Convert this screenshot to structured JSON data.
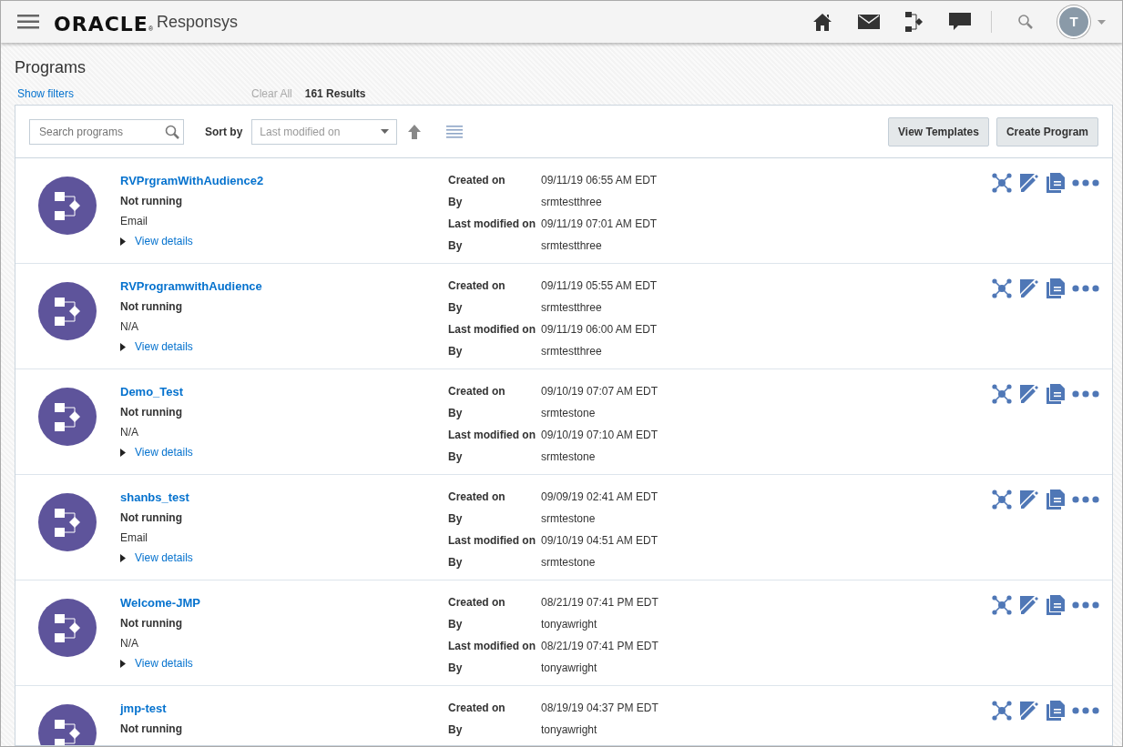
{
  "header": {
    "logo": "ORACLE",
    "logo_mark": "®",
    "product": "Responsys",
    "avatar_initial": "T"
  },
  "page_title": "Programs",
  "filter_bar": {
    "show_filters": "Show filters",
    "clear_all": "Clear All",
    "results": "161 Results"
  },
  "toolbar": {
    "search": {
      "placeholder": "Search programs"
    },
    "sort_label": "Sort by",
    "sort": {
      "placeholder": "Last modified on"
    },
    "buttons": [
      "View Templates",
      "Create Program"
    ]
  },
  "programs": [
    {
      "name": "RVPrgramWithAudience2",
      "status": "Not running",
      "type": "Email",
      "toggle": "View details",
      "expanded": false,
      "details": [
        {
          "label": "Created on",
          "value": "09/11/19 06:55 AM EDT"
        },
        {
          "label": "By",
          "value": "srmtestthree"
        },
        {
          "label": "Last modified on",
          "value": "09/11/19 07:01 AM EDT"
        },
        {
          "label": "By",
          "value": "srmtestthree"
        }
      ]
    },
    {
      "name": "RVProgramwithAudience",
      "status": "Not running",
      "type": "N/A",
      "toggle": "View details",
      "expanded": false,
      "details": [
        {
          "label": "Created on",
          "value": "09/11/19 05:55 AM EDT"
        },
        {
          "label": "By",
          "value": "srmtestthree"
        },
        {
          "label": "Last modified on",
          "value": "09/11/19 06:00 AM EDT"
        },
        {
          "label": "By",
          "value": "srmtestthree"
        }
      ]
    },
    {
      "name": "Demo_Test",
      "status": "Not running",
      "type": "N/A",
      "toggle": "View details",
      "expanded": false,
      "details": [
        {
          "label": "Created on",
          "value": "09/10/19 07:07 AM EDT"
        },
        {
          "label": "By",
          "value": "srmtestone"
        },
        {
          "label": "Last modified on",
          "value": "09/10/19 07:10 AM EDT"
        },
        {
          "label": "By",
          "value": "srmtestone"
        }
      ]
    },
    {
      "name": "shanbs_test",
      "status": "Not running",
      "type": "Email",
      "toggle": "View details",
      "expanded": false,
      "details": [
        {
          "label": "Created on",
          "value": "09/09/19 02:41 AM EDT"
        },
        {
          "label": "By",
          "value": "srmtestone"
        },
        {
          "label": "Last modified on",
          "value": "09/10/19 04:51 AM EDT"
        },
        {
          "label": "By",
          "value": "srmtestone"
        }
      ]
    },
    {
      "name": "Welcome-JMP",
      "status": "Not running",
      "type": "N/A",
      "toggle": "View details",
      "expanded": false,
      "details": [
        {
          "label": "Created on",
          "value": "08/21/19 07:41 PM EDT"
        },
        {
          "label": "By",
          "value": "tonyawright"
        },
        {
          "label": "Last modified on",
          "value": "08/21/19 07:41 PM EDT"
        },
        {
          "label": "By",
          "value": "tonyawright"
        }
      ]
    },
    {
      "name": "jmp-test",
      "status": "Not running",
      "details": [
        {
          "label": "Created on",
          "value": "08/19/19 04:37 PM EDT"
        },
        {
          "label": "By",
          "value": "tonyawright"
        }
      ]
    }
  ]
}
